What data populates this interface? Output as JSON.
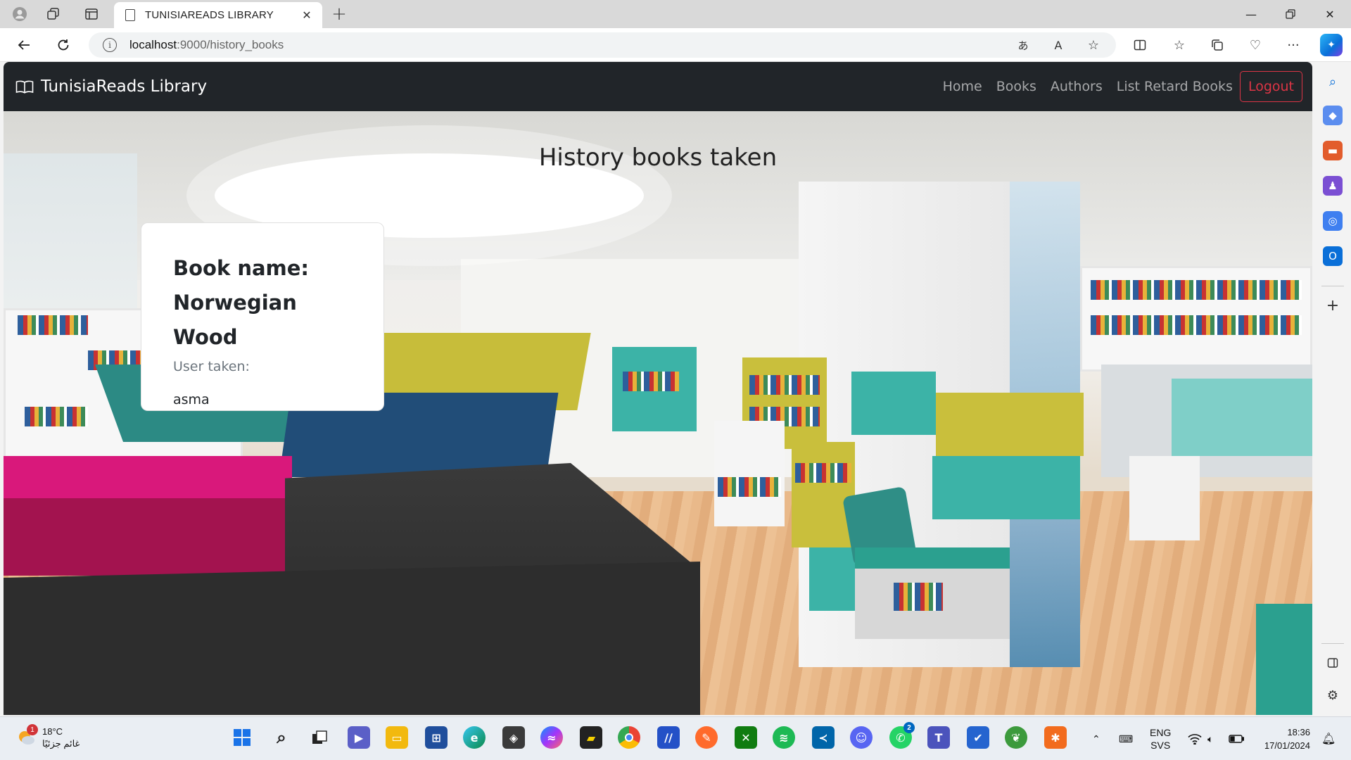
{
  "browser": {
    "tab_title": "TUNISIAREADS LIBRARY",
    "url_host": "localhost",
    "url_path": ":9000/history_books"
  },
  "navbar": {
    "brand": "TunisiaReads Library",
    "links": [
      "Home",
      "Books",
      "Authors",
      "List Retard Books"
    ],
    "logout": "Logout"
  },
  "page": {
    "heading": "History books taken",
    "card": {
      "book_label": "Book name:",
      "book_name": "Norwegian Wood",
      "user_label": "User taken:",
      "user_name": "asma"
    }
  },
  "taskbar": {
    "weather_temp": "18°C",
    "weather_desc": "غائم جزئيًا",
    "weather_badge": "1",
    "whatsapp_badge": "2",
    "language": "ENG",
    "layout": "SVS",
    "time": "18:36",
    "date": "17/01/2024"
  },
  "colors": {
    "navbar_bg": "#212529",
    "logout": "#dc3545",
    "edge_accent": "#0078d4"
  }
}
